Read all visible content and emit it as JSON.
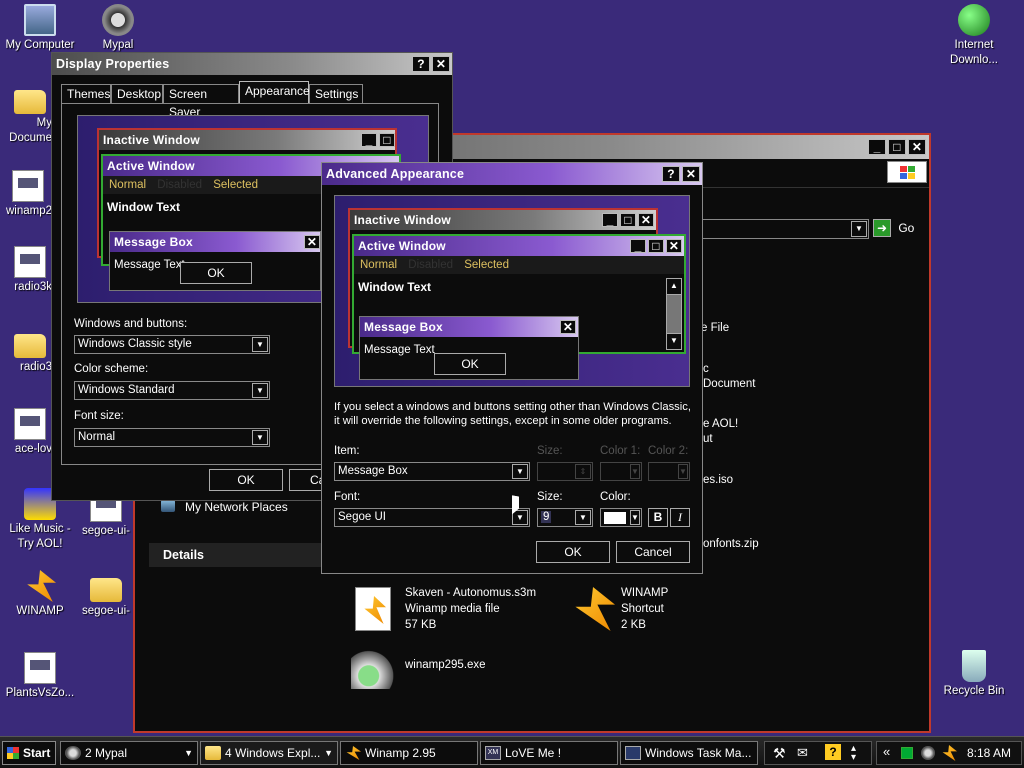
{
  "desktop": {
    "icons": [
      {
        "label": "My Computer"
      },
      {
        "label": "Mypal"
      },
      {
        "label": "My Docume"
      },
      {
        "label": "winamp2"
      },
      {
        "label": "radio3k"
      },
      {
        "label": "radio3"
      },
      {
        "label": "ace-lov"
      },
      {
        "label": "Like Music - Try AOL!"
      },
      {
        "label": "segoe-ui-"
      },
      {
        "label": "WINAMP"
      },
      {
        "label": "segoe-ui-"
      },
      {
        "label": "PlantsVsZo..."
      },
      {
        "label": "Internet Downlo..."
      },
      {
        "label": "Recycle Bin"
      }
    ]
  },
  "explorer": {
    "go_label": "Go",
    "network_places": "My Network Places",
    "details": "Details",
    "files": [
      {
        "name": "e File"
      },
      {
        "name": "Document",
        "prefix": "c"
      },
      {
        "name": "e AOL!"
      },
      {
        "name": "ut"
      },
      {
        "name": "es.iso"
      },
      {
        "name": "onfonts.zip"
      }
    ],
    "items": [
      {
        "name": "Skaven - Autonomus.s3m",
        "type": "Winamp media file",
        "size": "57 KB"
      },
      {
        "name": "WINAMP",
        "type": "Shortcut",
        "size": "2 KB"
      },
      {
        "name": "winamp295.exe"
      }
    ]
  },
  "display_properties": {
    "title": "Display Properties",
    "tabs": [
      "Themes",
      "Desktop",
      "Screen Saver",
      "Appearance",
      "Settings"
    ],
    "preview": {
      "inactive": "Inactive Window",
      "active": "Active Window",
      "normal": "Normal",
      "disabled": "Disabled",
      "selected": "Selected",
      "window_text": "Window Text",
      "msgbox": "Message Box",
      "msgtext": "Message Text",
      "ok": "OK"
    },
    "windows_buttons_label": "Windows and buttons:",
    "windows_buttons_value": "Windows Classic style",
    "color_scheme_label": "Color scheme:",
    "color_scheme_value": "Windows Standard",
    "font_size_label": "Font size:",
    "font_size_value": "Normal",
    "ok": "OK",
    "cancel": "Ca"
  },
  "advanced": {
    "title": "Advanced Appearance",
    "preview": {
      "inactive": "Inactive Window",
      "active": "Active Window",
      "normal": "Normal",
      "disabled": "Disabled",
      "selected": "Selected",
      "window_text": "Window Text",
      "msgbox": "Message Box",
      "msgtext": "Message Text",
      "ok": "OK"
    },
    "info_line1": "If you select a windows and buttons setting other than Windows Classic,",
    "info_line2": "it will override the following settings, except in some older programs.",
    "item_label": "Item:",
    "item_value": "Message Box",
    "size_label": "Size:",
    "color1_label": "Color 1:",
    "color2_label": "Color 2:",
    "font_label": "Font:",
    "font_value": "Segoe UI",
    "font_size_label": "Size:",
    "font_size_value": "9",
    "color_label": "Color:",
    "bold": "B",
    "italic": "I",
    "ok": "OK",
    "cancel": "Cancel"
  },
  "taskbar": {
    "start": "Start",
    "tasks": [
      {
        "label": "2 Mypal"
      },
      {
        "label": "4 Windows Expl..."
      },
      {
        "label": "Winamp 2.95"
      },
      {
        "label": "LoVE Me !"
      },
      {
        "label": "Windows Task Ma..."
      }
    ],
    "clock": "8:18 AM",
    "chevron": "«"
  },
  "colors": {
    "desktop": "#3a2a7a",
    "accent": "#8a5ad0"
  }
}
